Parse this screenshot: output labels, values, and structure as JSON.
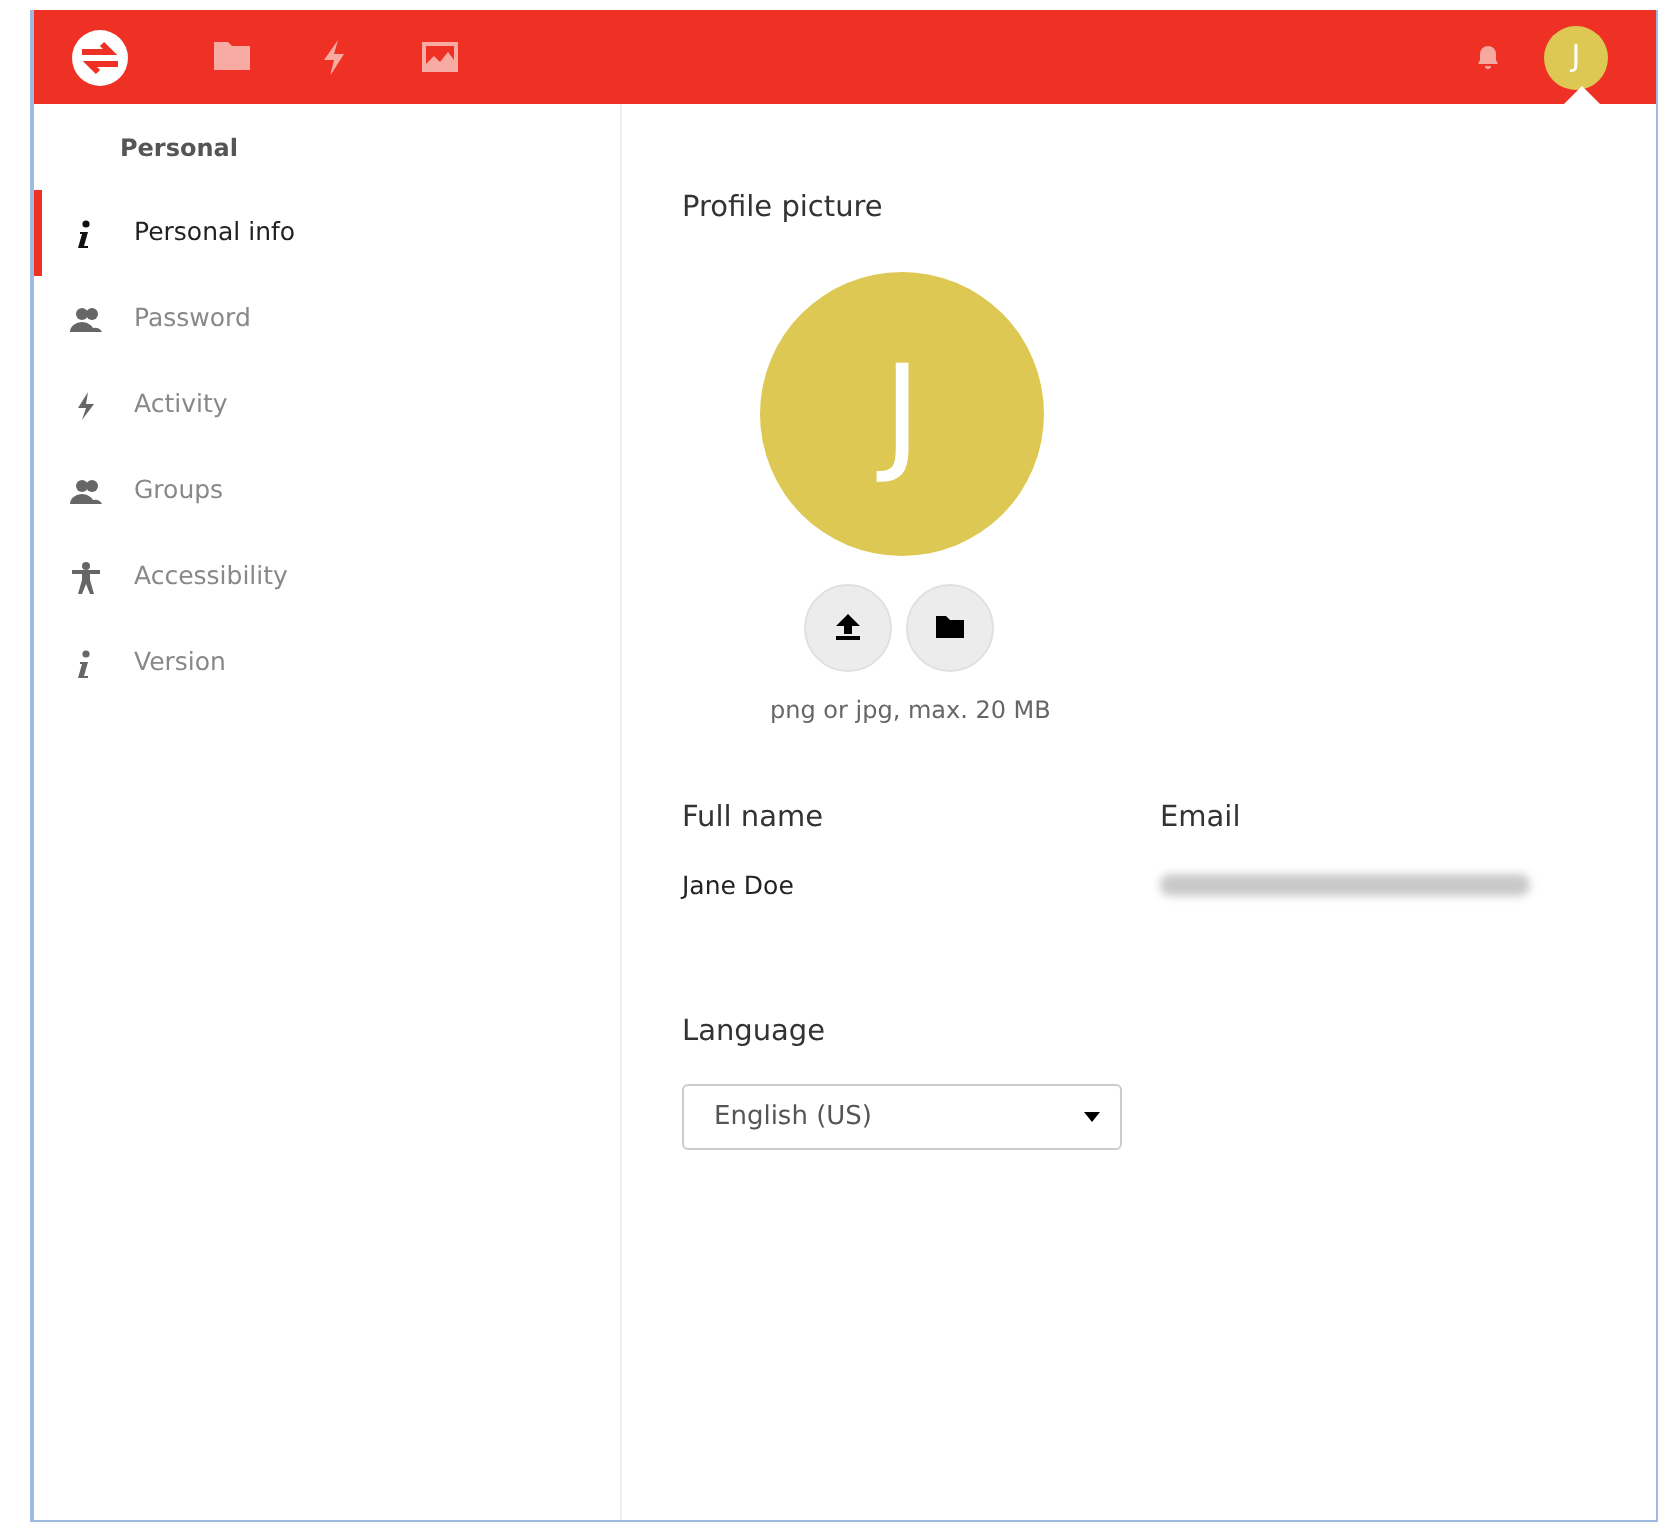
{
  "header": {
    "apps": [
      {
        "kind": "files"
      },
      {
        "kind": "activity"
      },
      {
        "kind": "gallery"
      }
    ],
    "avatar_initial": "J"
  },
  "sidebar": {
    "heading": "Personal",
    "items": [
      {
        "label": "Personal info",
        "kind": "info",
        "selected": true
      },
      {
        "label": "Password",
        "kind": "people",
        "selected": false
      },
      {
        "label": "Activity",
        "kind": "bolt",
        "selected": false
      },
      {
        "label": "Groups",
        "kind": "people",
        "selected": false
      },
      {
        "label": "Accessibility",
        "kind": "person",
        "selected": false
      },
      {
        "label": "Version",
        "kind": "info",
        "selected": false
      }
    ]
  },
  "profile": {
    "title": "Profile picture",
    "initial": "J",
    "hint": "png or jpg, max. 20 MB"
  },
  "full_name": {
    "label": "Full name",
    "value": "Jane Doe"
  },
  "email": {
    "label": "Email"
  },
  "language": {
    "label": "Language",
    "value": "English (US)"
  }
}
